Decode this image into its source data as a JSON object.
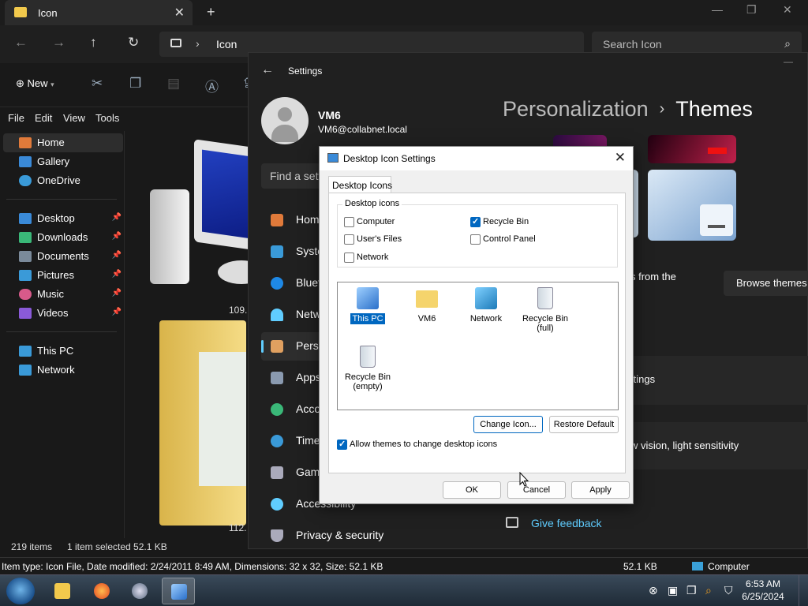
{
  "explorer": {
    "tab_title": "Icon",
    "address_crumb": "Icon",
    "search_placeholder": "Search Icon",
    "new_label": "New",
    "menu": [
      "File",
      "Edit",
      "View",
      "Tools"
    ],
    "sidebar": [
      {
        "label": "Home",
        "icon": "home-icon",
        "color": "#e07a3a"
      },
      {
        "label": "Gallery",
        "icon": "gallery-icon",
        "color": "#3a8ad8"
      },
      {
        "label": "OneDrive",
        "icon": "cloud-icon",
        "color": "#3a9ad8"
      },
      {
        "label": "Desktop",
        "icon": "desktop-icon",
        "color": "#3a8ad8"
      },
      {
        "label": "Downloads",
        "icon": "download-icon",
        "color": "#3ab878"
      },
      {
        "label": "Documents",
        "icon": "documents-icon",
        "color": "#7a8a9a"
      },
      {
        "label": "Pictures",
        "icon": "pictures-icon",
        "color": "#3a9ad8"
      },
      {
        "label": "Music",
        "icon": "music-icon",
        "color": "#d85a8a"
      },
      {
        "label": "Videos",
        "icon": "videos-icon",
        "color": "#8a5ad8"
      },
      {
        "label": "This PC",
        "icon": "pc-icon",
        "color": "#3a9ad8"
      },
      {
        "label": "Network",
        "icon": "network-icon",
        "color": "#3a9ad8"
      }
    ],
    "content_captions": [
      "109.",
      "112."
    ],
    "status": {
      "items": "219 items",
      "selected": "1 item selected  52.1 KB"
    },
    "info": {
      "details": "Item type: Icon File, Date modified: 2/24/2011 8:49 AM, Dimensions: 32 x 32, Size: 52.1 KB",
      "size": "52.1 KB",
      "location": "Computer"
    }
  },
  "settings": {
    "title": "Settings",
    "user_name": "VM6",
    "user_email": "VM6@collabnet.local",
    "find_placeholder": "Find a setti",
    "nav": [
      {
        "label": "Hom",
        "icon": "home-icon",
        "color": "#e07a3a"
      },
      {
        "label": "Syste",
        "icon": "system-icon",
        "color": "#3a9ad8"
      },
      {
        "label": "Bluet",
        "icon": "bluetooth-icon",
        "color": "#1e88e5"
      },
      {
        "label": "Netw",
        "icon": "wifi-icon",
        "color": "#60cdff"
      },
      {
        "label": "Perso",
        "icon": "brush-icon",
        "color": "#e0a060"
      },
      {
        "label": "Apps",
        "icon": "apps-icon",
        "color": "#8a9ab0"
      },
      {
        "label": "Acco",
        "icon": "account-icon",
        "color": "#3ab878"
      },
      {
        "label": "Time",
        "icon": "time-icon",
        "color": "#3a9ad8"
      },
      {
        "label": "Gami",
        "icon": "gaming-icon",
        "color": "#aab"
      },
      {
        "label": "Accessibility",
        "icon": "accessibility-icon",
        "color": "#60cdff"
      },
      {
        "label": "Privacy & security",
        "icon": "shield-icon",
        "color": "#aab"
      }
    ],
    "breadcrumb_parent": "Personalization",
    "breadcrumb_current": "Themes",
    "from_the_text": "s from the",
    "browse_label": "Browse themes",
    "settings_text": "ttings",
    "vision_text": "w vision, light sensitivity",
    "feedback_label": "Give feedback"
  },
  "dialog": {
    "title": "Desktop Icon Settings",
    "tab": "Desktop Icons",
    "group_title": "Desktop icons",
    "checkboxes": [
      {
        "label": "Computer",
        "checked": false
      },
      {
        "label": "User's Files",
        "checked": false
      },
      {
        "label": "Network",
        "checked": false
      },
      {
        "label": "Recycle Bin",
        "checked": true
      },
      {
        "label": "Control Panel",
        "checked": false
      }
    ],
    "icons": [
      {
        "label": "This PC",
        "selected": true
      },
      {
        "label": "VM6",
        "selected": false
      },
      {
        "label": "Network",
        "selected": false
      },
      {
        "label": "Recycle Bin\n(full)",
        "selected": false
      },
      {
        "label": "Recycle Bin\n(empty)",
        "selected": false
      }
    ],
    "change_icon": "Change Icon...",
    "restore_default": "Restore Default",
    "allow_themes": "Allow themes to change desktop icons",
    "allow_themes_checked": true,
    "ok": "OK",
    "cancel": "Cancel",
    "apply": "Apply"
  },
  "taskbar": {
    "time": "6:53 AM",
    "date": "6/25/2024"
  }
}
